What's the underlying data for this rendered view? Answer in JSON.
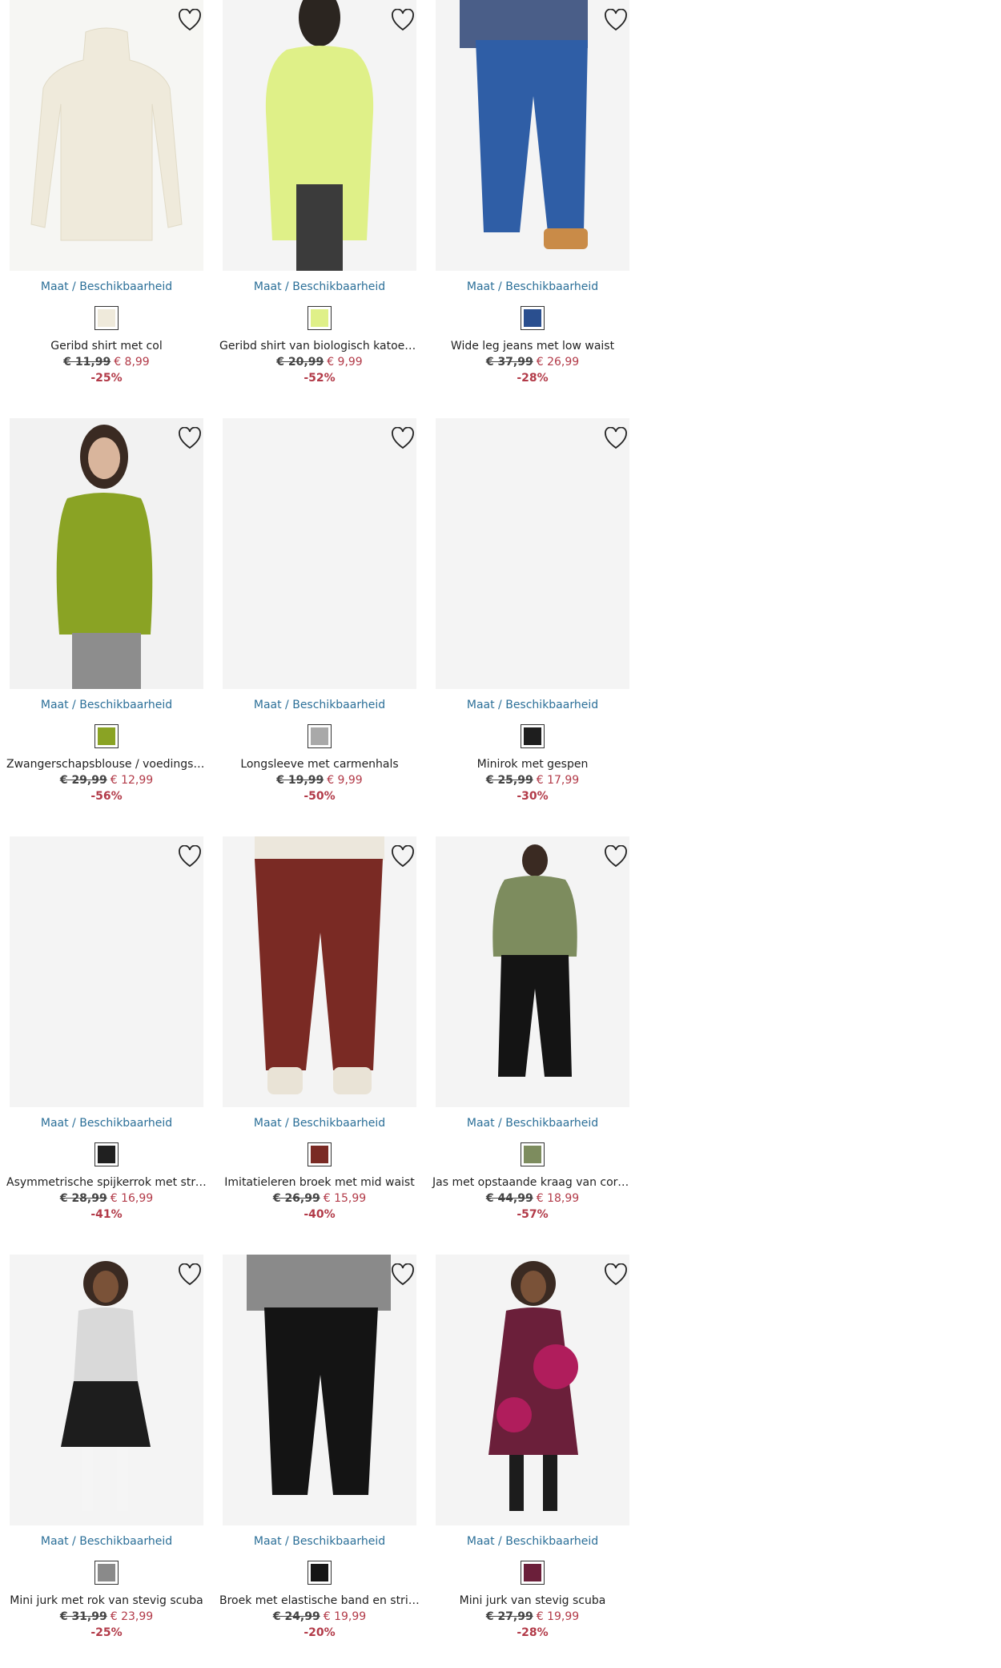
{
  "size_link_label": "Maat / Beschikbaarheid",
  "colors": {
    "link": "#2b6f98",
    "sale": "#b23a48"
  },
  "products": [
    {
      "name": "Geribd shirt met col",
      "old_price": "€ 11,99",
      "new_price": "€ 8,99",
      "discount": "-25%",
      "swatch": "#efeadb",
      "photo": "cream-turtleneck"
    },
    {
      "name": "Geribd shirt van biologisch katoen …",
      "old_price": "€ 20,99",
      "new_price": "€ 9,99",
      "discount": "-52%",
      "swatch": "#dff088",
      "photo": "lime-shirt"
    },
    {
      "name": "Wide leg jeans met low waist",
      "old_price": "€ 37,99",
      "new_price": "€ 26,99",
      "discount": "-28%",
      "swatch": "#2a4f8f",
      "photo": "blue-jeans"
    },
    {
      "name": "Zwangerschapsblouse / voedingsbl…",
      "old_price": "€ 29,99",
      "new_price": "€ 12,99",
      "discount": "-56%",
      "swatch": "#8aa324",
      "photo": "olive-blouse"
    },
    {
      "name": "Longsleeve met carmenhals",
      "old_price": "€ 19,99",
      "new_price": "€ 9,99",
      "discount": "-50%",
      "swatch": "#a9a9a9",
      "photo": "empty"
    },
    {
      "name": "Minirok met gespen",
      "old_price": "€ 25,99",
      "new_price": "€ 17,99",
      "discount": "-30%",
      "swatch": "#1e1e1e",
      "photo": "empty"
    },
    {
      "name": "Asymmetrische spijkerrok met stre…",
      "old_price": "€ 28,99",
      "new_price": "€ 16,99",
      "discount": "-41%",
      "swatch": "#202020",
      "photo": "empty"
    },
    {
      "name": "Imitatieleren broek met mid waist",
      "old_price": "€ 26,99",
      "new_price": "€ 15,99",
      "discount": "-40%",
      "swatch": "#7a2a24",
      "photo": "red-leather-pants"
    },
    {
      "name": "Jas met opstaande kraag van cordu…",
      "old_price": "€ 44,99",
      "new_price": "€ 18,99",
      "discount": "-57%",
      "swatch": "#7d8c5e",
      "photo": "green-jacket"
    },
    {
      "name": "Mini jurk met rok van stevig scuba",
      "old_price": "€ 31,99",
      "new_price": "€ 23,99",
      "discount": "-25%",
      "swatch": "#8a8a8a",
      "photo": "houndstooth-dress"
    },
    {
      "name": "Broek met elastische band en strik…",
      "old_price": "€ 24,99",
      "new_price": "€ 19,99",
      "discount": "-20%",
      "swatch": "#151515",
      "photo": "black-joggers"
    },
    {
      "name": "Mini jurk van stevig scuba",
      "old_price": "€ 27,99",
      "new_price": "€ 19,99",
      "discount": "-28%",
      "swatch": "#6b1f3a",
      "photo": "floral-dress"
    }
  ]
}
